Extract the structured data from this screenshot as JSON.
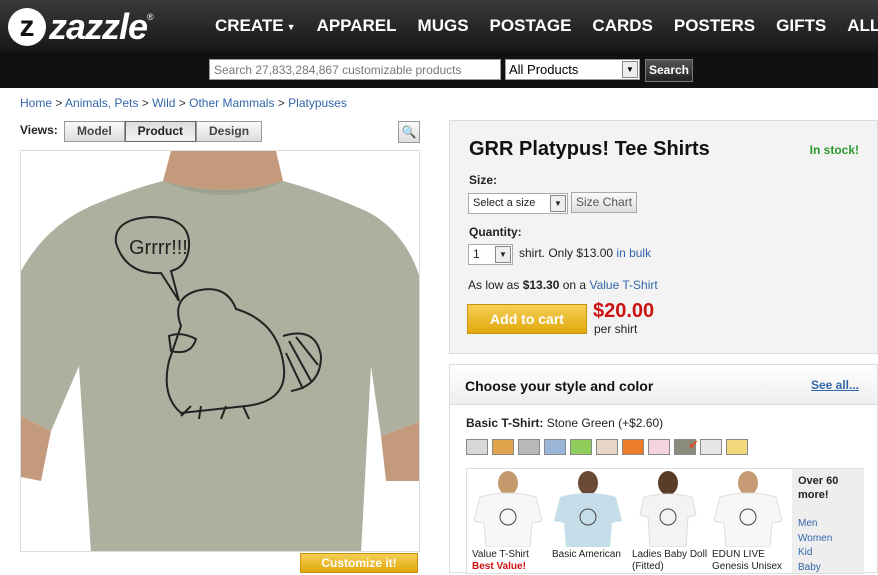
{
  "brand": {
    "mark": "z",
    "name": "zazzle",
    "reg": "®"
  },
  "nav": {
    "items": [
      "CREATE",
      "APPAREL",
      "MUGS",
      "POSTAGE",
      "CARDS",
      "POSTERS",
      "GIFTS",
      "ALL"
    ]
  },
  "search": {
    "placeholder": "Search 27,833,284,867 customizable products",
    "category": "All Products",
    "button": "Search"
  },
  "breadcrumb": {
    "items": [
      "Home",
      "Animals, Pets",
      "Wild",
      "Other Mammals",
      "Platypuses"
    ],
    "separator": " > "
  },
  "views": {
    "label": "Views:",
    "tabs": [
      "Model",
      "Product",
      "Design"
    ],
    "active": "Product"
  },
  "product": {
    "speech": "Grrrr!!!",
    "customize_label": "Customize it!",
    "shirt_color": "#aeb09f"
  },
  "buy": {
    "title": "GRR Platypus! Tee Shirts",
    "stock": "In stock!",
    "size_label": "Size:",
    "size_value": "Select a size",
    "size_chart": "Size Chart",
    "qty_label": "Quantity:",
    "qty_value": "1",
    "qty_text": "shirt. Only $13.00",
    "bulk_link": "in bulk",
    "aslow_prefix": "As low as",
    "aslow_price": "$13.30",
    "aslow_mid": "on a",
    "aslow_link": "Value T-Shirt",
    "add_to_cart": "Add to cart",
    "price": "$20.00",
    "per": "per shirt"
  },
  "style": {
    "title": "Choose your style and color",
    "see_all": "See all...",
    "type_label": "Basic T-Shirt:",
    "color_name": "Stone Green",
    "color_price": "(+$2.60)",
    "swatches": [
      "#d8d8d8",
      "#e0a24a",
      "#b9b9b9",
      "#9ab5d8",
      "#8fce5a",
      "#e7d6c6",
      "#ee7d2a",
      "#f3d4df",
      "#8b8b7c",
      "#e7e7e7",
      "#f2d97c"
    ],
    "selected_swatch": 8,
    "thumbnails": [
      {
        "name": "Value T-Shirt",
        "tag": "Best Value!"
      },
      {
        "name": "Basic American",
        "tag": ""
      },
      {
        "name": "Ladies Baby Doll (Fitted)",
        "tag": ""
      },
      {
        "name": "EDUN LIVE Genesis Unisex",
        "tag": ""
      }
    ],
    "more_title": "Over 60 more!",
    "more_links": [
      "Men",
      "Women",
      "Kid",
      "Baby"
    ]
  }
}
